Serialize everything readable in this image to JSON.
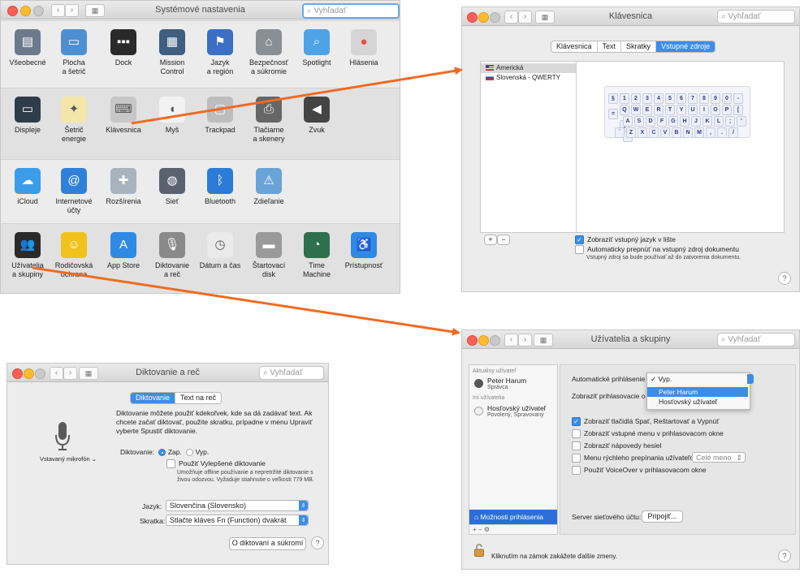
{
  "main": {
    "title": "Systémové nastavenia",
    "search_placeholder": "Vyhľadať",
    "rows": [
      [
        {
          "label": "Všeobecné",
          "icon": "general-icon"
        },
        {
          "label": "Plocha\na šetrič",
          "icon": "desktop-icon"
        },
        {
          "label": "Dock",
          "icon": "dock-icon"
        },
        {
          "label": "Mission\nControl",
          "icon": "mission-control-icon"
        },
        {
          "label": "Jazyk\na región",
          "icon": "globe-flag-icon"
        },
        {
          "label": "Bezpečnosť\na súkromie",
          "icon": "house-lock-icon"
        },
        {
          "label": "Spotlight",
          "icon": "magnifier-icon"
        },
        {
          "label": "Hlásenia",
          "icon": "notifications-icon"
        }
      ],
      [
        {
          "label": "Displeje",
          "icon": "display-icon"
        },
        {
          "label": "Šetrič\nenergie",
          "icon": "bulb-icon"
        },
        {
          "label": "Klávesnica",
          "icon": "keyboard-icon"
        },
        {
          "label": "Myš",
          "icon": "mouse-icon"
        },
        {
          "label": "Trackpad",
          "icon": "trackpad-icon"
        },
        {
          "label": "Tlačiarne\na skenery",
          "icon": "printer-icon"
        },
        {
          "label": "Zvuk",
          "icon": "speaker-icon"
        }
      ],
      [
        {
          "label": "iCloud",
          "icon": "cloud-icon"
        },
        {
          "label": "Internetové\núčty",
          "icon": "at-icon"
        },
        {
          "label": "Rozšírenia",
          "icon": "puzzle-icon"
        },
        {
          "label": "Sieť",
          "icon": "network-globe-icon"
        },
        {
          "label": "Bluetooth",
          "icon": "bluetooth-icon"
        },
        {
          "label": "Zdieľanie",
          "icon": "sharing-folder-icon"
        }
      ],
      [
        {
          "label": "Užívatelia\na skupiny",
          "icon": "users-icon"
        },
        {
          "label": "Rodičovská\nochrana",
          "icon": "parental-icon"
        },
        {
          "label": "App Store",
          "icon": "appstore-icon"
        },
        {
          "label": "Diktovanie\na reč",
          "icon": "microphone-icon"
        },
        {
          "label": "Dátum a čas",
          "icon": "clock-calendar-icon"
        },
        {
          "label": "Štartovací\ndisk",
          "icon": "disk-icon"
        },
        {
          "label": "Time\nMachine",
          "icon": "timemachine-icon"
        },
        {
          "label": "Prístupnosť",
          "icon": "accessibility-icon"
        }
      ]
    ]
  },
  "keyboard": {
    "title": "Klávesnica",
    "search_placeholder": "Vyhľadať",
    "tabs": [
      "Klávesnica",
      "Text",
      "Skratky",
      "Vstupné zdroje"
    ],
    "active_tab": "Vstupné zdroje",
    "sources": [
      "Americká",
      "Slovenská - QWERTY"
    ],
    "key_rows": [
      [
        "§",
        "1",
        "2",
        "3",
        "4",
        "5",
        "6",
        "7",
        "8",
        "9",
        "0",
        "-",
        "="
      ],
      [
        "Q",
        "W",
        "E",
        "R",
        "T",
        "Y",
        "U",
        "I",
        "O",
        "P",
        "[",
        "]"
      ],
      [
        "A",
        "S",
        "D",
        "F",
        "G",
        "H",
        "J",
        "K",
        "L",
        ";",
        "'",
        "\\"
      ],
      [
        "`",
        "Z",
        "X",
        "C",
        "V",
        "B",
        "N",
        "M",
        ",",
        ".",
        "/"
      ]
    ],
    "add": "+",
    "remove": "−",
    "show_menu": "Zobraziť vstupný jazyk v lište",
    "auto_switch": "Automaticky prepnúť na vstupný zdroj dokumentu",
    "auto_note": "Vstupný zdroj sa bude používať až do zatvorenia dokumentu.",
    "help": "?"
  },
  "dictation": {
    "title": "Diktovanie a reč",
    "search_placeholder": "Vyhľadať",
    "tabs": [
      "Diktovanie",
      "Text na reč"
    ],
    "description": "Diktovanie môžete použiť kdekoľvek, kde sa dá zadávať text. Ak chcete začať diktovať, použite skratku, prípadne v menu Upraviť vyberte Spustiť diktovanie.",
    "mic_label": "Vstavaný mikrofón",
    "dictation_label": "Diktovanie:",
    "on_label": "Zap.",
    "off_label": "Vyp.",
    "enhanced_label": "Použiť Vylepšené diktovanie",
    "enhanced_note": "Umožňuje offline používanie a nepretržité diktovanie s živou odozvou. Vyžaduje stiahnutie o veľkosti 779 MB.",
    "language_label": "Jazyk:",
    "language_value": "Slovenčina (Slovensko)",
    "shortcut_label": "Skratka:",
    "shortcut_value": "Stlačte kláves Fn (Function) dvakrát",
    "privacy_button": "O diktovaní a súkromí",
    "help": "?"
  },
  "users": {
    "title": "Užívatelia a skupiny",
    "search_placeholder": "Vyhľadať",
    "current_header": "Aktuálny užívateľ",
    "current_name": "Peter Harum",
    "current_role": "Správca",
    "other_header": "Iní užívatelia",
    "guest_name": "Hosťovský užívateľ",
    "guest_role": "Povolený, Spravovaný",
    "login_options": "Možnosti prihlásenia",
    "auto_login_label": "Automatické prihlásenie",
    "auto_login_menu": [
      "Vyp.",
      "Peter Harum",
      "Hosťovský užívateľ"
    ],
    "auto_login_checked": "Vyp.",
    "show_window_label": "Zobraziť prihlasovacie o",
    "opt_sleep": "Zobraziť tlačidlá Spať, Reštartovať a Vypnúť",
    "opt_input": "Zobraziť vstupné menu v prihlasovacom okne",
    "opt_hints": "Zobraziť nápovedy hesiel",
    "opt_fast": "Menu rýchleho prepínania užívateľov",
    "fast_value": "Celé meno",
    "opt_voiceover": "Použiť VoiceOver v prihlasovacom okne",
    "server_label": "Server sieťového účtu:",
    "connect_button": "Pripojiť...",
    "lock_text": "Kliknutím na zámok zakážete ďalšie zmeny.",
    "help": "?"
  },
  "colors": {
    "accent": "#3b8de8",
    "arrow": "#f26a21"
  }
}
